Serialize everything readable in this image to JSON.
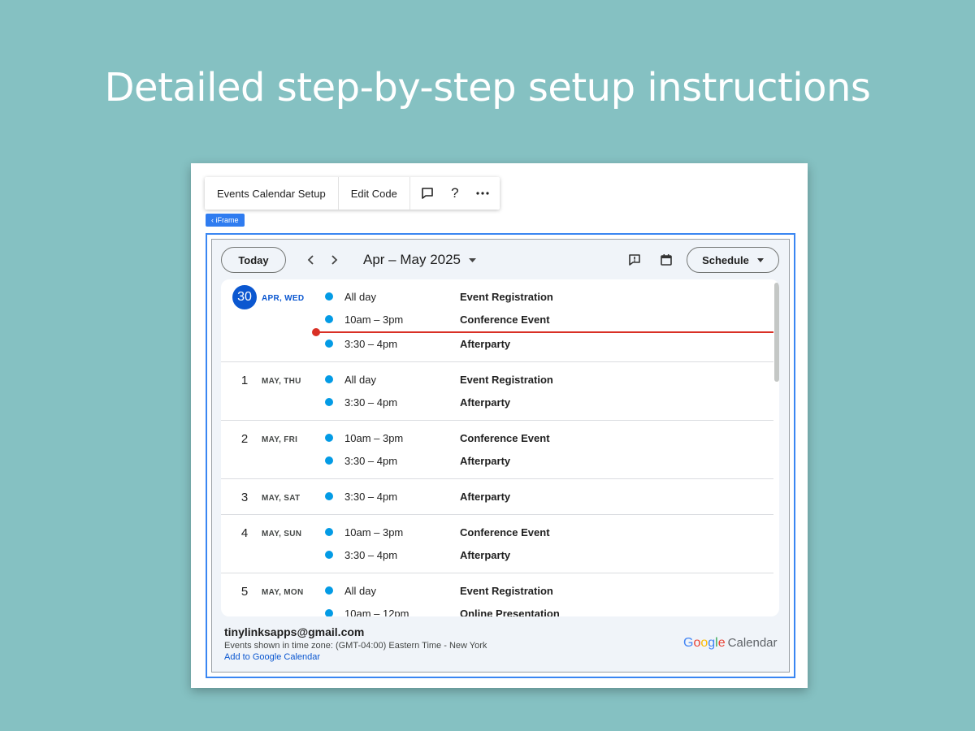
{
  "hero": {
    "title": "Detailed step-by-step setup instructions"
  },
  "toolbar": {
    "setup_label": "Events Calendar Setup",
    "edit_label": "Edit Code",
    "icons": [
      "comment-icon",
      "help-icon",
      "more-icon"
    ]
  },
  "iframe_tag": "‹ iFrame",
  "calendar": {
    "today_label": "Today",
    "range_label": "Apr – May 2025",
    "view_label": "Schedule",
    "days": [
      {
        "num": "30",
        "label": "APR, WED",
        "current": true,
        "events": [
          {
            "time": "All day",
            "title": "Event Registration"
          },
          {
            "time": "10am – 3pm",
            "title": "Conference Event"
          },
          {
            "time": "3:30 – 4pm",
            "title": "Afterparty"
          }
        ]
      },
      {
        "num": "1",
        "label": "MAY, THU",
        "events": [
          {
            "time": "All day",
            "title": "Event Registration"
          },
          {
            "time": "3:30 – 4pm",
            "title": "Afterparty"
          }
        ]
      },
      {
        "num": "2",
        "label": "MAY, FRI",
        "events": [
          {
            "time": "10am – 3pm",
            "title": "Conference Event"
          },
          {
            "time": "3:30 – 4pm",
            "title": "Afterparty"
          }
        ]
      },
      {
        "num": "3",
        "label": "MAY, SAT",
        "events": [
          {
            "time": "3:30 – 4pm",
            "title": "Afterparty"
          }
        ]
      },
      {
        "num": "4",
        "label": "MAY, SUN",
        "events": [
          {
            "time": "10am – 3pm",
            "title": "Conference Event"
          },
          {
            "time": "3:30 – 4pm",
            "title": "Afterparty"
          }
        ]
      },
      {
        "num": "5",
        "label": "MAY, MON",
        "events": [
          {
            "time": "All day",
            "title": "Event Registration"
          },
          {
            "time": "10am – 12pm",
            "title": "Online Presentation"
          }
        ]
      }
    ],
    "event_color": "#039be5",
    "now_color": "#d93025"
  },
  "footer": {
    "account": "tinylinksapps@gmail.com",
    "timezone": "Events shown in time zone: (GMT-04:00) Eastern Time - New York",
    "add_link": "Add to Google Calendar",
    "brand_google": "Google",
    "brand_calendar": "Calendar"
  }
}
